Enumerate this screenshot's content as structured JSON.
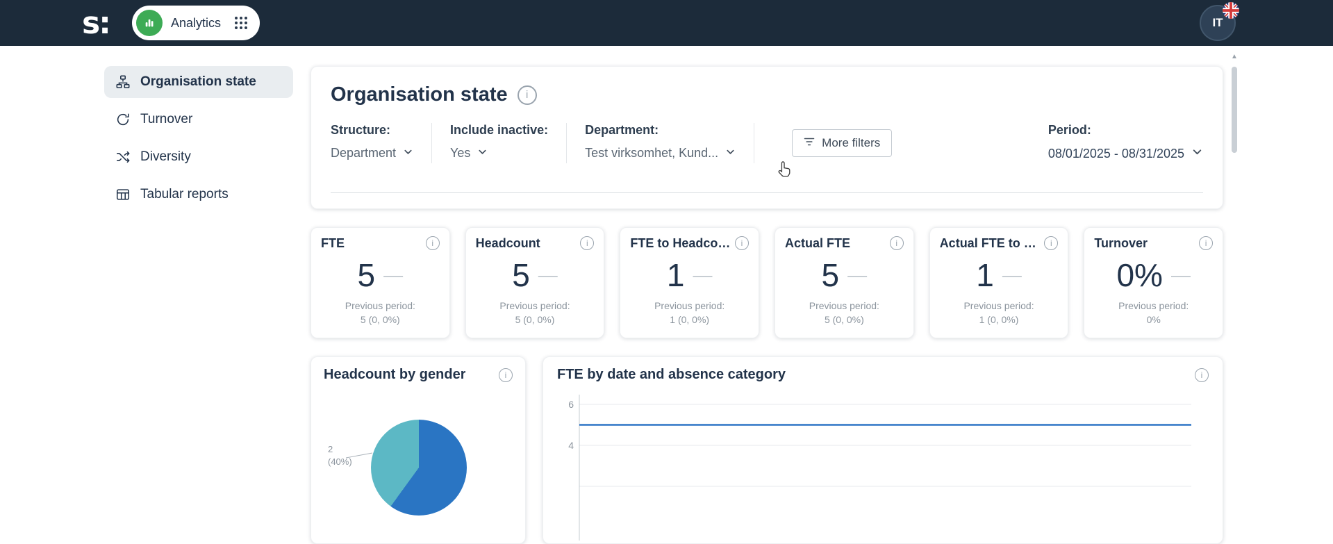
{
  "ui": {
    "info_glyph": "i",
    "scroll_up_glyph": "▲"
  },
  "topbar": {
    "logo": "s:",
    "app_name": "Analytics",
    "avatar_initials": "IT"
  },
  "sidebar": {
    "items": [
      {
        "label": "Organisation state",
        "icon": "org-chart-icon",
        "active": true
      },
      {
        "label": "Turnover",
        "icon": "turnover-cycle-icon",
        "active": false
      },
      {
        "label": "Diversity",
        "icon": "diversity-shuffle-icon",
        "active": false
      },
      {
        "label": "Tabular reports",
        "icon": "table-icon",
        "active": false
      }
    ]
  },
  "panel": {
    "title": "Organisation state",
    "filters": {
      "structure_label": "Structure:",
      "structure_value": "Department",
      "inactive_label": "Include inactive:",
      "inactive_value": "Yes",
      "department_label": "Department:",
      "department_value": "Test virksomhet, Kund...",
      "more_filters_label": "More filters",
      "period_label": "Period:",
      "period_value": "08/01/2025 - 08/31/2025"
    }
  },
  "kpis": [
    {
      "title": "FTE",
      "value": "5",
      "trend": "—",
      "prev_label": "Previous period:",
      "prev_value": "5 (0, 0%)"
    },
    {
      "title": "Headcount",
      "value": "5",
      "trend": "—",
      "prev_label": "Previous period:",
      "prev_value": "5 (0, 0%)"
    },
    {
      "title": "FTE to Headcou...",
      "value": "1",
      "trend": "—",
      "prev_label": "Previous period:",
      "prev_value": "1 (0, 0%)"
    },
    {
      "title": "Actual FTE",
      "value": "5",
      "trend": "—",
      "prev_label": "Previous period:",
      "prev_value": "5 (0, 0%)"
    },
    {
      "title": "Actual FTE to FTE",
      "value": "1",
      "trend": "—",
      "prev_label": "Previous period:",
      "prev_value": "1 (0, 0%)"
    },
    {
      "title": "Turnover",
      "value": "0%",
      "trend": "—",
      "prev_label": "Previous period:",
      "prev_value": "0%"
    }
  ],
  "bottom": {
    "gender_title": "Headcount by gender",
    "gender_callout_line1": "2",
    "gender_callout_line2": "(40%)",
    "fte_title": "FTE by date and absence category",
    "ytick_top": "6",
    "ytick_mid": "4"
  },
  "chart_data": [
    {
      "type": "pie",
      "title": "Headcount by gender",
      "slices": [
        {
          "label": "2 (40%)",
          "value": 40,
          "color": "#5cb8c5"
        },
        {
          "label": "",
          "value": 60,
          "color": "#2a75c3"
        }
      ],
      "annotations": [
        "2 (40%)"
      ]
    },
    {
      "type": "line",
      "title": "FTE by date and absence category",
      "x_range": [
        "08/01/2025",
        "08/31/2025"
      ],
      "series": [
        {
          "name": "FTE",
          "constant_value": 5
        }
      ],
      "yticks_visible": [
        6,
        4
      ],
      "ylim_visible": [
        3.5,
        6.5
      ],
      "grid": true,
      "line_color": "#2e75c6"
    }
  ]
}
